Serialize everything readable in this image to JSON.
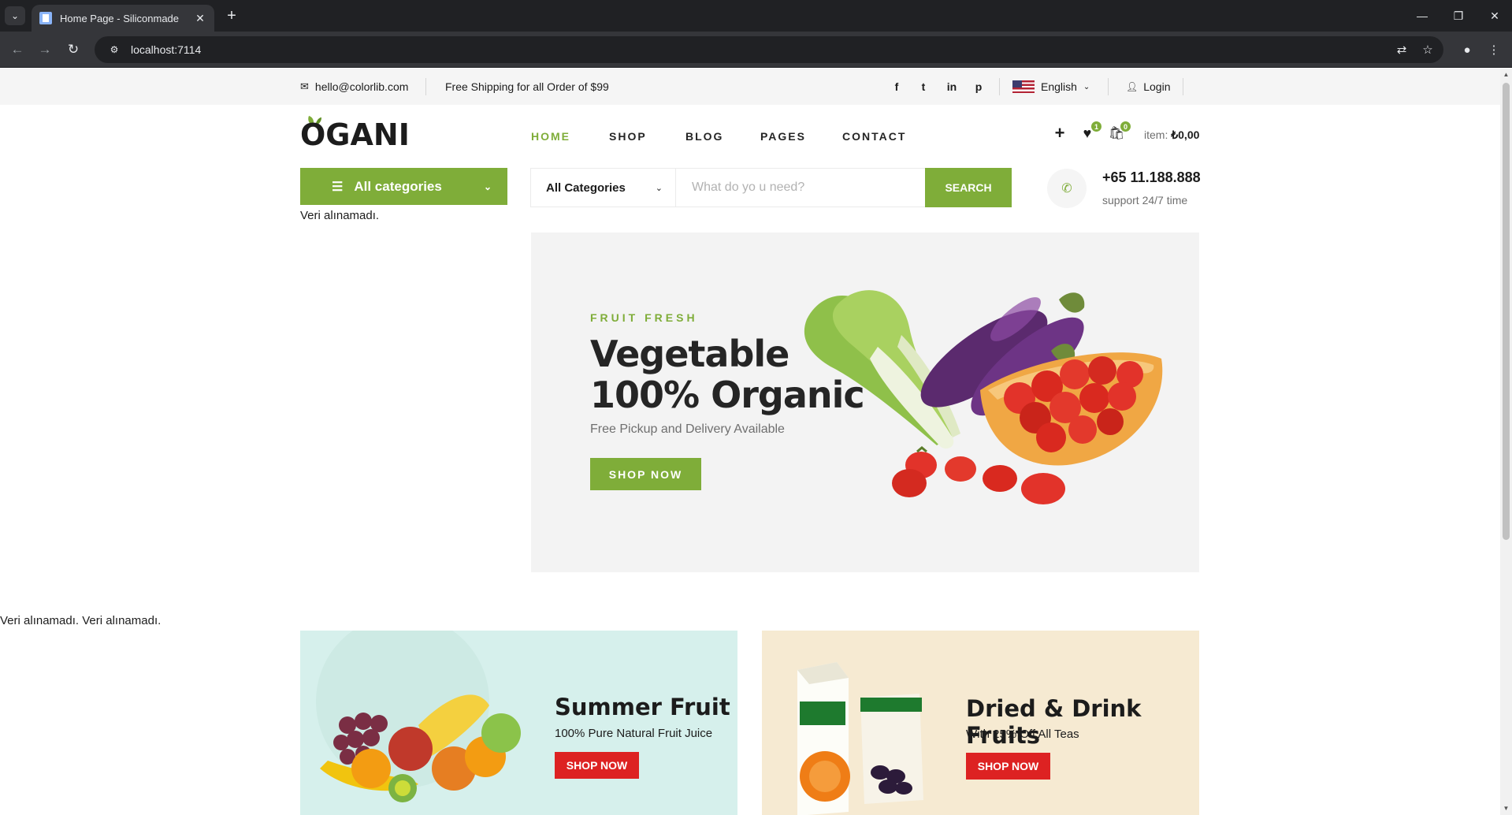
{
  "browser": {
    "tab_title": "Home Page - Siliconmade",
    "url": "localhost:7114",
    "tab_close": "✕",
    "new_tab": "+"
  },
  "header_top": {
    "email": "hello@colorlib.com",
    "shipping_text": "Free Shipping for all Order of $99",
    "language": "English",
    "login": "Login",
    "social": [
      "f",
      "t",
      "in",
      "p"
    ]
  },
  "logo": {
    "text": "OGANI"
  },
  "nav": {
    "items": [
      "HOME",
      "SHOP",
      "BLOG",
      "PAGES",
      "CONTACT"
    ],
    "active": "HOME"
  },
  "header_actions": {
    "wishlist_count": "1",
    "cart_count": "0",
    "item_label": "item:",
    "item_total": "₺0,00"
  },
  "categories": {
    "button_label": "All categories",
    "error_text": "Veri alınamadı."
  },
  "search": {
    "category_label": "All Categories",
    "placeholder": "What do yo u need?",
    "button_label": "SEARCH"
  },
  "phone": {
    "number": "+65 11.188.888",
    "support": "support 24/7 time"
  },
  "hero": {
    "kicker": "FRUIT FRESH",
    "title_line1": "Vegetable",
    "title_line2": "100% Organic",
    "subtitle": "Free Pickup and Delivery Available",
    "button": "SHOP NOW"
  },
  "body_error": "Veri alınamadı. Veri alınamadı.",
  "banners": [
    {
      "title": "Summer Fruit",
      "subtitle": "100% Pure Natural Fruit Juice",
      "button": "SHOP NOW"
    },
    {
      "title": "Dried & Drink Fruits",
      "subtitle": "With 25% Off All Teas",
      "button": "SHOP NOW"
    }
  ],
  "colors": {
    "accent": "#7fad39",
    "banner_button": "#dd2222",
    "banner1_bg": "#d6f0ec",
    "banner2_bg": "#f6ead2"
  }
}
